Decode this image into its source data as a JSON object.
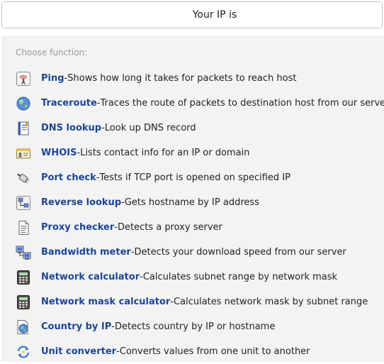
{
  "header": {
    "ip_label": "Your IP is"
  },
  "panel": {
    "choose_label": "Choose function:"
  },
  "functions": [
    {
      "name": "Ping",
      "desc": "Shows how long it takes for packets to reach host",
      "icon": "ping-icon"
    },
    {
      "name": "Traceroute",
      "desc": "Traces the route of packets to destination host from our server",
      "icon": "globe-icon"
    },
    {
      "name": "DNS lookup",
      "desc": "Look up DNS record",
      "icon": "book-icon"
    },
    {
      "name": "WHOIS",
      "desc": "Lists contact info for an IP or domain",
      "icon": "id-card-icon"
    },
    {
      "name": "Port check",
      "desc": "Tests if TCP port is opened on specified IP",
      "icon": "plug-icon"
    },
    {
      "name": "Reverse lookup",
      "desc": "Gets hostname by IP address",
      "icon": "network-icon"
    },
    {
      "name": "Proxy checker",
      "desc": "Detects a proxy server",
      "icon": "document-icon"
    },
    {
      "name": "Bandwidth meter",
      "desc": "Detects your download speed from our server",
      "icon": "computers-icon"
    },
    {
      "name": "Network calculator",
      "desc": "Calculates subnet range by network mask",
      "icon": "calculator-icon"
    },
    {
      "name": "Network mask calculator",
      "desc": "Calculates network mask by subnet range",
      "icon": "calculator-icon"
    },
    {
      "name": "Country by IP",
      "desc": "Detects country by IP or hostname",
      "icon": "globe-document-icon"
    },
    {
      "name": "Unit converter",
      "desc": "Converts values from one unit to another",
      "icon": "refresh-icon"
    }
  ],
  "separator": " - "
}
